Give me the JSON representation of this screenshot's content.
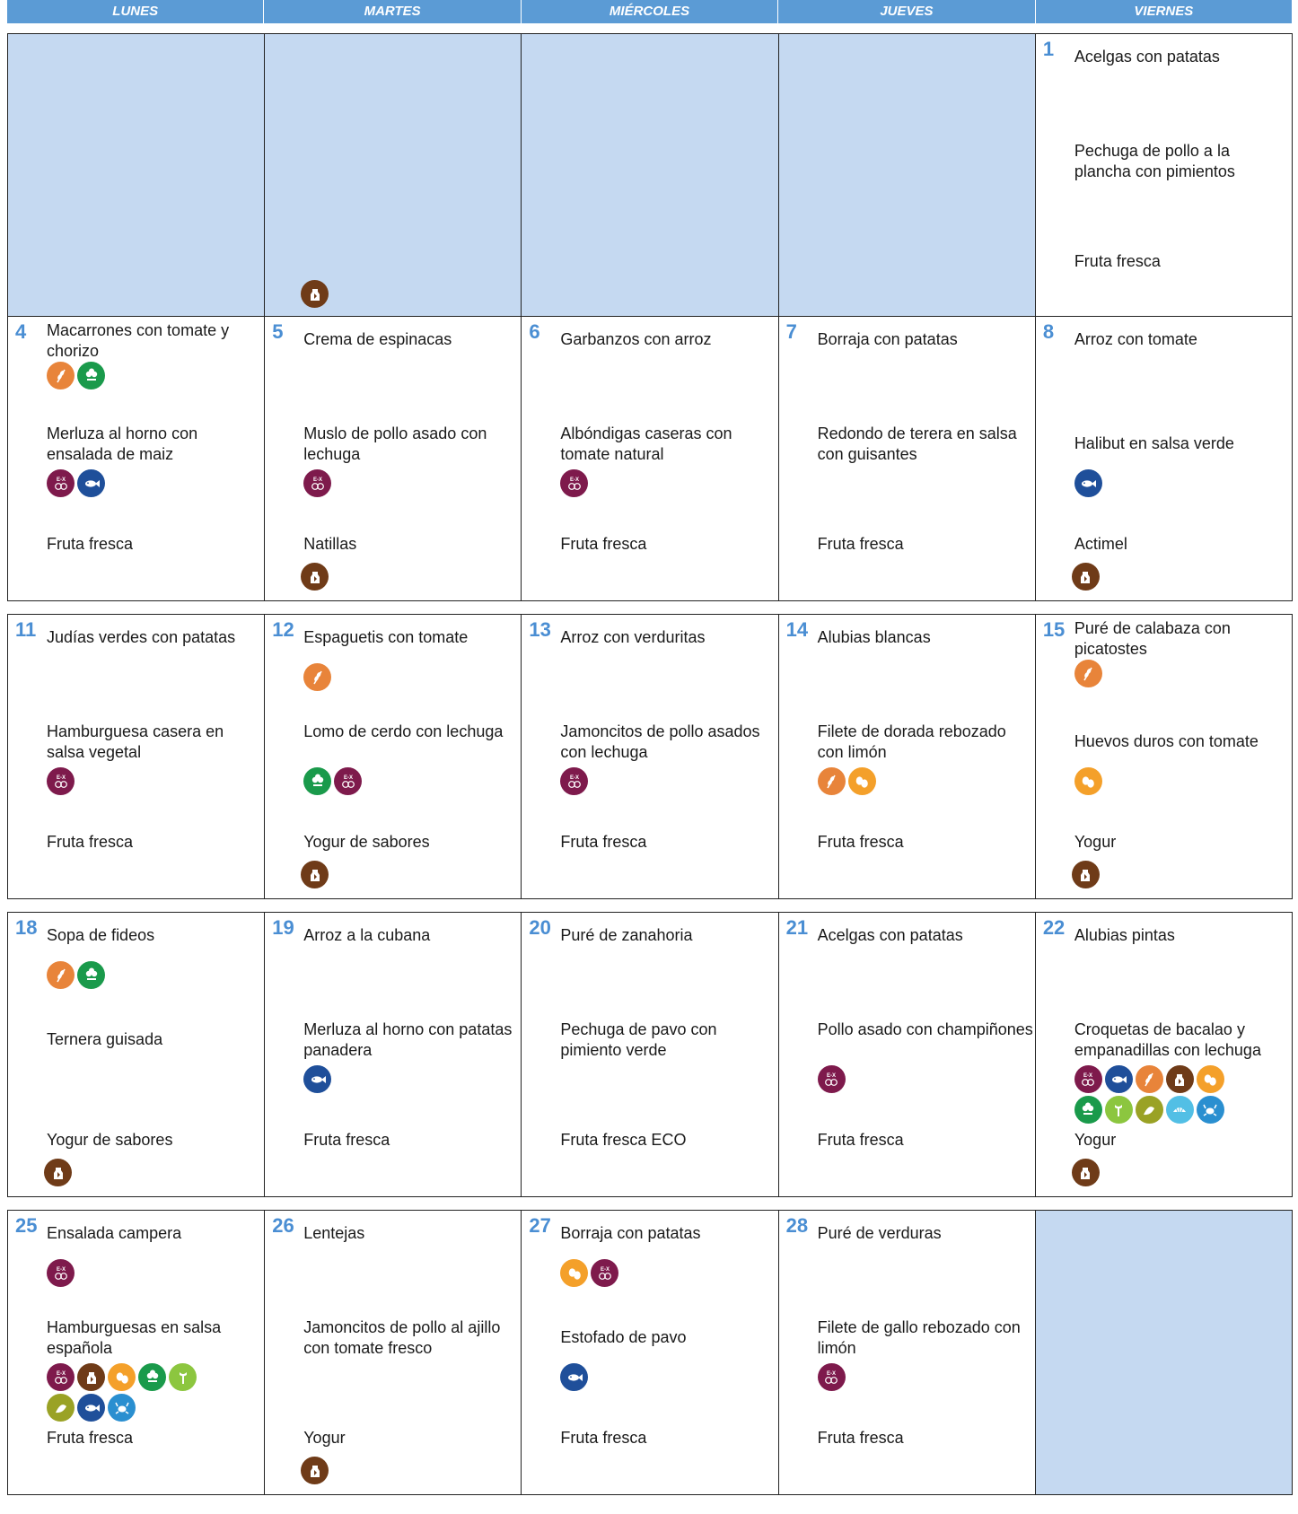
{
  "header": {
    "days": [
      "LUNES",
      "MARTES",
      "MIÉRCOLES",
      "JUEVES",
      "VIERNES"
    ]
  },
  "weeks": [
    {
      "cells": [
        {
          "empty": true,
          "icons_bottom": []
        },
        {
          "empty": true,
          "icons_bottom": [
            "milk"
          ]
        },
        {
          "empty": true,
          "icons_bottom": []
        },
        {
          "empty": true,
          "icons_bottom": []
        },
        {
          "empty": false,
          "date": "1",
          "first": "Acelgas con patatas",
          "first_icons": [],
          "second": "Pechuga de pollo a la plancha con pimientos",
          "second_icons": [],
          "dessert": "Fruta fresca",
          "dessert_icons": []
        }
      ]
    },
    {
      "cells": [
        {
          "empty": false,
          "date": "4",
          "first": "Macarrones con tomate y chorizo",
          "first_icons": [
            "gluten",
            "celery"
          ],
          "second": "Merluza al horno con ensalada de maiz",
          "second_icons": [
            "sulphites",
            "fish"
          ],
          "dessert": "Fruta fresca",
          "dessert_icons": []
        },
        {
          "empty": false,
          "date": "5",
          "first": "Crema de espinacas",
          "first_icons": [],
          "second": "Muslo de pollo asado con lechuga",
          "second_icons": [
            "sulphites"
          ],
          "dessert": "Natillas",
          "dessert_icons": [
            "milk"
          ]
        },
        {
          "empty": false,
          "date": "6",
          "first": "Garbanzos con arroz",
          "first_icons": [],
          "second": "Albóndigas caseras con tomate natural",
          "second_icons": [
            "sulphites"
          ],
          "dessert": "Fruta fresca",
          "dessert_icons": []
        },
        {
          "empty": false,
          "date": "7",
          "first": "Borraja con patatas",
          "first_icons": [],
          "second": "Redondo de terera en salsa con guisantes",
          "second_icons": [],
          "dessert": "Fruta fresca",
          "dessert_icons": []
        },
        {
          "empty": false,
          "date": "8",
          "first": "Arroz con tomate",
          "first_icons": [],
          "second": "Halibut en salsa verde",
          "second_icons": [
            "fish"
          ],
          "dessert": "Actimel",
          "dessert_icons": [
            "milk"
          ]
        }
      ]
    },
    {
      "cells": [
        {
          "empty": false,
          "date": "11",
          "first": "Judías verdes con patatas",
          "first_icons": [],
          "second": "Hamburguesa casera en salsa vegetal",
          "second_icons": [
            "sulphites"
          ],
          "dessert": "Fruta fresca",
          "dessert_icons": []
        },
        {
          "empty": false,
          "date": "12",
          "first": "Espaguetis con tomate",
          "first_icons": [
            "gluten"
          ],
          "second": "Lomo de cerdo con lechuga",
          "second_icons": [
            "celery",
            "sulphites"
          ],
          "dessert": "Yogur de sabores",
          "dessert_icons": [
            "milk"
          ]
        },
        {
          "empty": false,
          "date": "13",
          "first": "Arroz con verduritas",
          "first_icons": [],
          "second": "Jamoncitos de pollo asados con lechuga",
          "second_icons": [
            "sulphites"
          ],
          "dessert": "Fruta fresca",
          "dessert_icons": []
        },
        {
          "empty": false,
          "date": "14",
          "first": "Alubias blancas",
          "first_icons": [],
          "second": "Filete de dorada rebozado con limón",
          "second_icons": [
            "gluten",
            "egg"
          ],
          "dessert": "Fruta fresca",
          "dessert_icons": []
        },
        {
          "empty": false,
          "date": "15",
          "first": "Puré de calabaza con picatostes",
          "first_icons": [
            "gluten"
          ],
          "second": "Huevos duros con tomate",
          "second_icons": [
            "egg"
          ],
          "dessert": "Yogur",
          "dessert_icons": [
            "milk"
          ]
        }
      ]
    },
    {
      "cells": [
        {
          "empty": false,
          "date": "18",
          "first": "Sopa de fideos",
          "first_icons": [
            "gluten",
            "celery"
          ],
          "second": "Ternera guisada",
          "second_icons": [],
          "dessert": "Yogur de sabores",
          "dessert_icons": [
            "milk"
          ]
        },
        {
          "empty": false,
          "date": "19",
          "first": "Arroz  a la cubana",
          "first_icons": [],
          "second": "Merluza al horno con patatas panadera",
          "second_icons": [
            "fish"
          ],
          "dessert": "Fruta fresca",
          "dessert_icons": []
        },
        {
          "empty": false,
          "date": "20",
          "first": "Puré de zanahoria",
          "first_icons": [],
          "second": "Pechuga de pavo con pimiento verde",
          "second_icons": [],
          "dessert": "Fruta fresca ECO",
          "dessert_icons": []
        },
        {
          "empty": false,
          "date": "21",
          "first": "Acelgas con patatas",
          "first_icons": [],
          "second": "Pollo asado con champiñones",
          "second_icons": [
            "sulphites"
          ],
          "dessert": "Fruta fresca",
          "dessert_icons": []
        },
        {
          "empty": false,
          "date": "22",
          "first": "Alubias pintas",
          "first_icons": [],
          "second": "Croquetas de bacalao y empanadillas con lechuga",
          "second_icons": [
            "sulphites",
            "fish",
            "gluten",
            "milk",
            "egg",
            "celery",
            "mustard",
            "sesame",
            "molluscs",
            "crustaceans"
          ],
          "dessert": "Yogur",
          "dessert_icons": [
            "milk"
          ]
        }
      ]
    },
    {
      "cells": [
        {
          "empty": false,
          "date": "25",
          "first": "Ensalada campera",
          "first_icons": [
            "sulphites"
          ],
          "second": "Hamburguesas en salsa española",
          "second_icons": [
            "sulphites",
            "milk",
            "egg",
            "celery",
            "mustard",
            "sesame",
            "fish",
            "crustaceans"
          ],
          "dessert": "Fruta fresca",
          "dessert_icons": []
        },
        {
          "empty": false,
          "date": "26",
          "first": "Lentejas",
          "first_icons": [],
          "second": "Jamoncitos de pollo al ajillo con tomate fresco",
          "second_icons": [],
          "dessert": "Yogur",
          "dessert_icons": [
            "milk"
          ]
        },
        {
          "empty": false,
          "date": "27",
          "first": "Borraja con patatas",
          "first_icons": [
            "egg",
            "sulphites"
          ],
          "second": "Estofado de pavo",
          "second_icons": [
            "fish"
          ],
          "dessert": "Fruta fresca",
          "dessert_icons": []
        },
        {
          "empty": false,
          "date": "28",
          "first": "Puré de verduras",
          "first_icons": [],
          "second": "Filete de gallo rebozado con limón",
          "second_icons": [
            "sulphites"
          ],
          "dessert": "Fruta fresca",
          "dessert_icons": []
        },
        {
          "empty": true,
          "icons_bottom": []
        }
      ]
    }
  ],
  "icon_colors": {
    "gluten": "#e8843a",
    "celery": "#1a9a4b",
    "sulphites": "#7e1a4c",
    "fish": "#1f4f9a",
    "milk": "#6f3b18",
    "egg": "#f4a02a",
    "mustard": "#8cc63f",
    "sesame": "#9aa225",
    "molluscs": "#52bfe5",
    "crustaceans": "#2a8fd0"
  },
  "icon_names": {
    "gluten": "gluten-wheat-icon",
    "celery": "celery-icon",
    "sulphites": "sulphites-icon",
    "fish": "fish-icon",
    "milk": "milk-icon",
    "egg": "egg-icon",
    "mustard": "mustard-icon",
    "sesame": "sesame-icon",
    "molluscs": "molluscs-shell-icon",
    "crustaceans": "crustaceans-crab-icon"
  }
}
